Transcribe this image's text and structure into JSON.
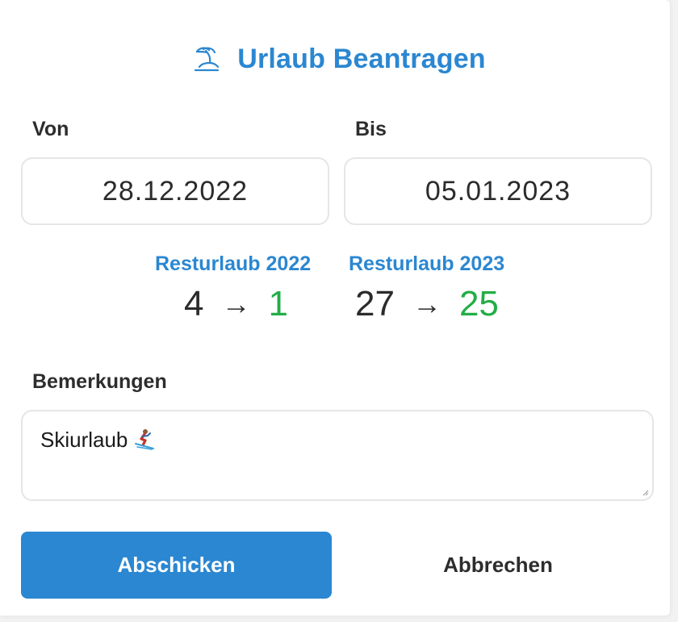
{
  "dialog": {
    "title": "Urlaub Beantragen",
    "title_icon": "palm-island-icon",
    "accent_color": "#2b87d1",
    "positive_color": "#23ad47"
  },
  "form": {
    "from_label": "Von",
    "from_value": "28.12.2022",
    "to_label": "Bis",
    "to_value": "05.01.2023",
    "remarks_label": "Bemerkungen",
    "remarks_value": "Skiurlaub",
    "remarks_emoji": "skier-icon"
  },
  "remaining": [
    {
      "label": "Resturlaub 2022",
      "before": "4",
      "arrow": "→",
      "after": "1"
    },
    {
      "label": "Resturlaub 2023",
      "before": "27",
      "arrow": "→",
      "after": "25"
    }
  ],
  "actions": {
    "submit_label": "Abschicken",
    "cancel_label": "Abbrechen"
  }
}
